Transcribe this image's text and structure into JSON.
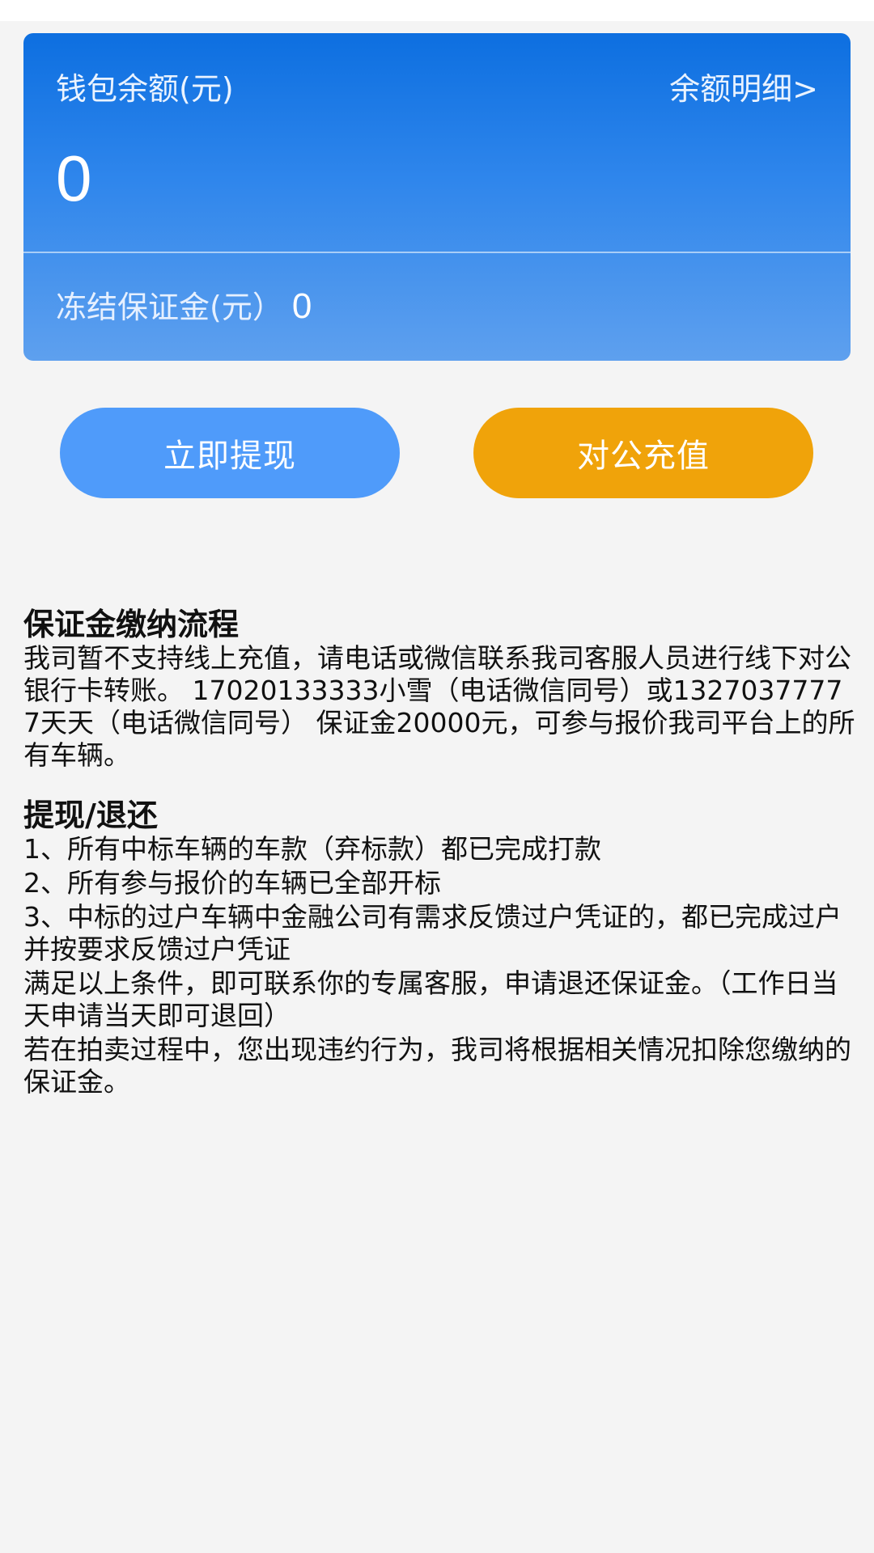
{
  "wallet": {
    "balance_label": "钱包余额(元)",
    "detail_link": "余额明细>",
    "balance_value": "0",
    "frozen_label": "冻结保证金(元）",
    "frozen_value": "0"
  },
  "actions": {
    "withdraw_label": "立即提现",
    "recharge_label": "对公充值"
  },
  "deposit_process": {
    "title": "保证金缴纳流程",
    "body": "我司暂不支持线上充值，请电话或微信联系我司客服人员进行线下对公银行卡转账。 17020133333小雪（电话微信同号）或13270377777天天（电话微信同号） 保证金20000元，可参与报价我司平台上的所有车辆。"
  },
  "withdraw_refund": {
    "title": "提现/退还",
    "items": [
      "1、所有中标车辆的车款（弃标款）都已完成打款",
      "2、所有参与报价的车辆已全部开标",
      "3、中标的过户车辆中金融公司有需求反馈过户凭证的，都已完成过户并按要求反馈过户凭证",
      "满足以上条件，即可联系你的专属客服，申请退还保证金。（工作日当天申请当天即可退回）",
      "若在拍卖过程中，您出现违约行为，我司将根据相关情况扣除您缴纳的保证金。"
    ]
  },
  "colors": {
    "card_gradient_top": "#0d6fe0",
    "card_gradient_bottom": "#5ea0ee",
    "withdraw_button": "#4f9bfa",
    "recharge_button": "#f0a30a",
    "page_background": "#f4f4f4"
  }
}
